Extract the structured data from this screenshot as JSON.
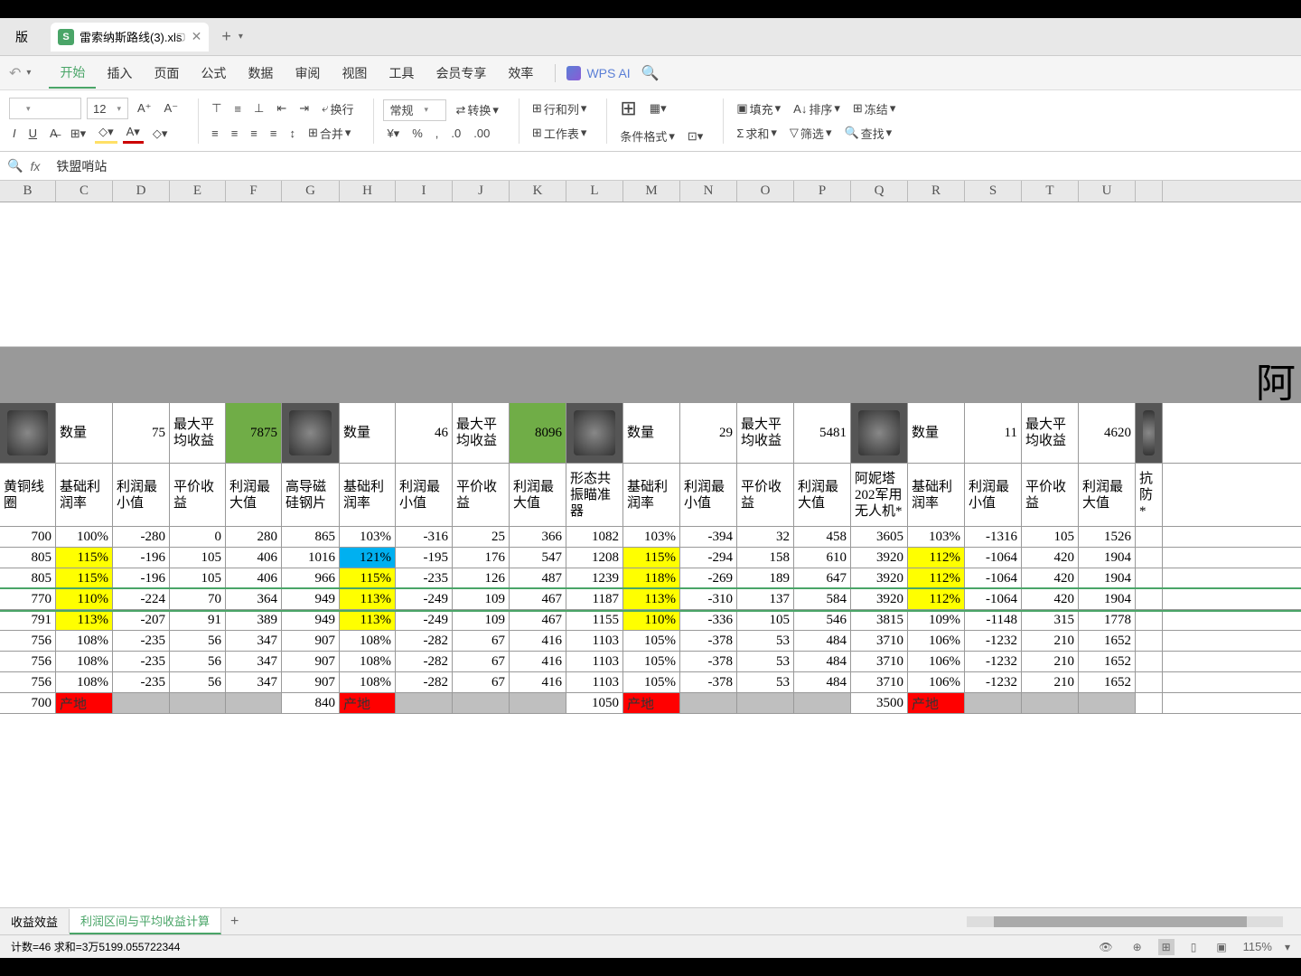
{
  "file": {
    "name": "雷索纳斯路线(3).xls"
  },
  "menu": {
    "items": [
      "开始",
      "插入",
      "页面",
      "公式",
      "数据",
      "审阅",
      "视图",
      "工具",
      "会员专享",
      "效率"
    ],
    "active": 0,
    "ai": "WPS AI"
  },
  "toolbar": {
    "fontsize": "12",
    "format": "常规",
    "wrap": "换行",
    "convert": "转换",
    "rowcol": "行和列",
    "worksheet": "工作表",
    "condfmt": "条件格式",
    "merge": "合并",
    "fill": "填充",
    "sort": "排序",
    "freeze": "冻结",
    "sum": "求和",
    "filter": "筛选",
    "find": "查找"
  },
  "formula": {
    "value": "铁盟哨站"
  },
  "cols": [
    "B",
    "C",
    "D",
    "E",
    "F",
    "G",
    "H",
    "I",
    "J",
    "K",
    "L",
    "M",
    "N",
    "O",
    "P",
    "Q",
    "R",
    "S",
    "T",
    "U"
  ],
  "graylabel": "阿",
  "sec_headers": {
    "qty": "数量",
    "maxavg": "最大平均收益",
    "sec1": {
      "qty": 75,
      "max": 7875
    },
    "sec2": {
      "qty": 46,
      "max": 8096
    },
    "sec3": {
      "qty": 29,
      "max": 5481
    },
    "sec4": {
      "qty": 11,
      "max": 4620
    }
  },
  "col_headers": {
    "B": "黄铜线圈",
    "C": "基础利润率",
    "D": "利润最小值",
    "E": "平价收益",
    "F": "利润最大值",
    "G": "高导磁硅钢片",
    "H": "基础利润率",
    "I": "利润最小值",
    "J": "平价收益",
    "K": "利润最大值",
    "L": "形态共振瞄准器",
    "M": "基础利润率",
    "N": "利润最小值",
    "O": "平价收益",
    "P": "利润最大值",
    "Q": "阿妮塔202军用无人机*",
    "R": "基础利润率",
    "S": "利润最小值",
    "T": "平价收益",
    "U": "利润最大值",
    "V": "抗防*"
  },
  "rows": [
    {
      "B": 700,
      "C": "100%",
      "D": -280,
      "E": 0,
      "F": 280,
      "G": 865,
      "H": "103%",
      "I": -316,
      "J": 25,
      "K": 366,
      "L": 1082,
      "M": "103%",
      "N": -394,
      "O": 32,
      "P": 458,
      "Q": 3605,
      "R": "103%",
      "S": -1316,
      "T": 105,
      "U": 1526
    },
    {
      "B": 805,
      "C": "115%",
      "Cy": 1,
      "D": -196,
      "E": 105,
      "F": 406,
      "G": 1016,
      "H": "121%",
      "Hb": 1,
      "I": -195,
      "J": 176,
      "K": 547,
      "L": 1208,
      "M": "115%",
      "My": 1,
      "N": -294,
      "O": 158,
      "P": 610,
      "Q": 3920,
      "R": "112%",
      "Ry": 1,
      "S": -1064,
      "T": 420,
      "U": 1904
    },
    {
      "B": 805,
      "C": "115%",
      "Cy": 1,
      "D": -196,
      "E": 105,
      "F": 406,
      "G": 966,
      "H": "115%",
      "Hy": 1,
      "I": -235,
      "J": 126,
      "K": 487,
      "L": 1239,
      "M": "118%",
      "My": 1,
      "N": -269,
      "O": 189,
      "P": 647,
      "Q": 3920,
      "R": "112%",
      "Ry": 1,
      "S": -1064,
      "T": 420,
      "U": 1904
    },
    {
      "sel": 1,
      "B": 770,
      "C": "110%",
      "Cy": 1,
      "D": -224,
      "E": 70,
      "F": 364,
      "G": 949,
      "H": "113%",
      "Hy": 1,
      "I": -249,
      "J": 109,
      "K": 467,
      "L": 1187,
      "M": "113%",
      "My": 1,
      "N": -310,
      "O": 137,
      "P": 584,
      "Q": 3920,
      "R": "112%",
      "Ry": 1,
      "S": -1064,
      "T": 420,
      "U": 1904
    },
    {
      "B": 791,
      "C": "113%",
      "Cy": 1,
      "D": -207,
      "E": 91,
      "F": 389,
      "G": 949,
      "H": "113%",
      "Hy": 1,
      "I": -249,
      "J": 109,
      "K": 467,
      "L": 1155,
      "M": "110%",
      "My": 1,
      "N": -336,
      "O": 105,
      "P": 546,
      "Q": 3815,
      "R": "109%",
      "S": -1148,
      "T": 315,
      "U": 1778
    },
    {
      "B": 756,
      "C": "108%",
      "D": -235,
      "E": 56,
      "F": 347,
      "G": 907,
      "H": "108%",
      "I": -282,
      "J": 67,
      "K": 416,
      "L": 1103,
      "M": "105%",
      "N": -378,
      "O": 53,
      "P": 484,
      "Q": 3710,
      "R": "106%",
      "S": -1232,
      "T": 210,
      "U": 1652
    },
    {
      "B": 756,
      "C": "108%",
      "D": -235,
      "E": 56,
      "F": 347,
      "G": 907,
      "H": "108%",
      "I": -282,
      "J": 67,
      "K": 416,
      "L": 1103,
      "M": "105%",
      "N": -378,
      "O": 53,
      "P": 484,
      "Q": 3710,
      "R": "106%",
      "S": -1232,
      "T": 210,
      "U": 1652
    },
    {
      "B": 756,
      "C": "108%",
      "D": -235,
      "E": 56,
      "F": 347,
      "G": 907,
      "H": "108%",
      "I": -282,
      "J": 67,
      "K": 416,
      "L": 1103,
      "M": "105%",
      "N": -378,
      "O": 53,
      "P": 484,
      "Q": 3710,
      "R": "106%",
      "S": -1232,
      "T": 210,
      "U": 1652
    },
    {
      "gray": 1,
      "B": 700,
      "C": "产地",
      "Cr": 1,
      "G": 840,
      "H": "产地",
      "Hr": 1,
      "L": 1050,
      "M": "产地",
      "Mr": 1,
      "Q": 3500,
      "R": "产地",
      "Rr": 1
    }
  ],
  "sheets": {
    "tabs": [
      "收益效益",
      "利润区间与平均收益计算"
    ],
    "active": 1
  },
  "status": {
    "left": "计数=46 求和=3万5199.055722344",
    "zoom": "115%"
  }
}
